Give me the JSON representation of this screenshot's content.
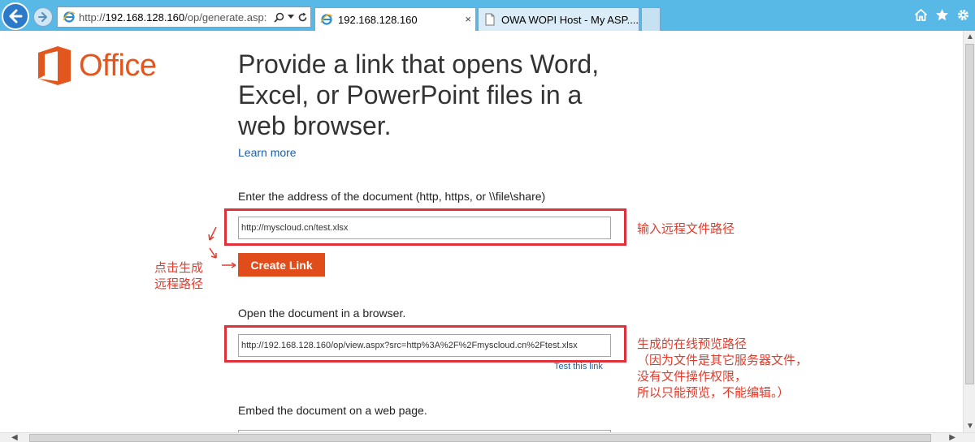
{
  "browser": {
    "address_prefix": "http://",
    "address_host": "192.168.128.160",
    "address_path": "/op/generate.asp:",
    "tabs": [
      {
        "label": "192.168.128.160",
        "active": true
      },
      {
        "label": "OWA WOPI Host - My ASP....",
        "active": false
      }
    ],
    "tab_close": "×",
    "search_icon": "search-icon",
    "accent": "#58b8e6"
  },
  "page": {
    "logo_text": "Office",
    "headline": "Provide a link that opens Word, Excel, or PowerPoint files in a web browser.",
    "learn_more": "Learn more",
    "address_label": "Enter the address of the document (http, https, or \\\\file\\share)",
    "address_value": "http://myscloud.cn/test.xlsx",
    "create_button": "Create Link",
    "open_label": "Open the document in a browser.",
    "open_value": "http://192.168.128.160/op/view.aspx?src=http%3A%2F%2Fmyscloud.cn%2Ftest.xlsx",
    "test_link": "Test this link",
    "embed_label": "Embed the document on a web page."
  },
  "annotations": {
    "input_note": "输入远程文件路径",
    "click_note_line1": "点击生成",
    "click_note_line2": "远程路径",
    "result_note_line1": "生成的在线预览路径",
    "result_note_line2": "（因为文件是其它服务器文件，",
    "result_note_line3": "没有文件操作权限，",
    "result_note_line4": "所以只能预览，不能编辑。）"
  }
}
